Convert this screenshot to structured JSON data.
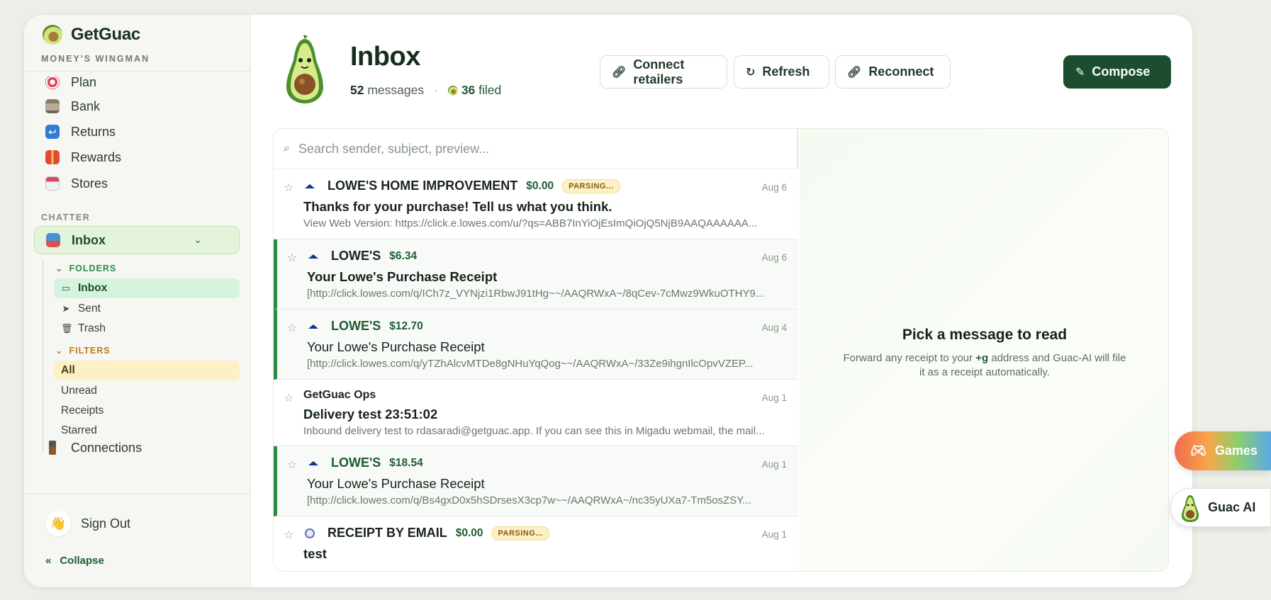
{
  "brand": {
    "name": "GetGuac",
    "tagline": "MONEY'S WINGMAN"
  },
  "sidebar": {
    "items": [
      {
        "label": "Plan",
        "icon": "target-icon"
      },
      {
        "label": "Bank",
        "icon": "bank-icon"
      },
      {
        "label": "Returns",
        "icon": "return-arrow-icon"
      },
      {
        "label": "Rewards",
        "icon": "gift-icon"
      },
      {
        "label": "Stores",
        "icon": "store-icon"
      }
    ],
    "chatter_label": "CHATTER",
    "inbox_label": "Inbox",
    "folders_label": "FOLDERS",
    "folders": [
      "Inbox",
      "Sent",
      "Trash"
    ],
    "filters_label": "FILTERS",
    "filters": [
      "All",
      "Unread",
      "Receipts",
      "Starred"
    ],
    "connections_label": "Connections",
    "signout_label": "Sign Out",
    "collapse_label": "Collapse"
  },
  "header": {
    "title": "Inbox",
    "message_count": "52",
    "messages_word": "messages",
    "filed_count": "36",
    "filed_word": "filed",
    "buttons": {
      "connect": "Connect retailers",
      "refresh": "Refresh",
      "reconnect": "Reconnect",
      "compose": "Compose"
    }
  },
  "search": {
    "placeholder": "Search sender, subject, preview..."
  },
  "messages": [
    {
      "sender": "LOWE'S HOME IMPROVEMENT",
      "amount": "$0.00",
      "badge": "PARSING...",
      "date": "Aug 6",
      "subject": "Thanks for your purchase! Tell us what you think.",
      "preview": "View Web Version: https://click.e.lowes.com/u/?qs=ABB7InYiOjEsImQiOjQ5NjB9AAQAAAAAA..."
    },
    {
      "sender": "LOWE'S",
      "amount": "$6.34",
      "date": "Aug 6",
      "subject": "Your Lowe's Purchase Receipt",
      "preview": "[http://click.lowes.com/q/ICh7z_VYNjzi1RbwJ91tHg~~/AAQRWxA~/8qCev-7cMwz9WkuOTHY9..."
    },
    {
      "sender": "LOWE'S",
      "amount": "$12.70",
      "date": "Aug 4",
      "subject": "Your Lowe's Purchase Receipt",
      "preview": "[http://click.lowes.com/q/yTZhAlcvMTDe8gNHuYqQog~~/AAQRWxA~/33Ze9ihgnIlcOpvVZEP..."
    },
    {
      "sender": "GetGuac Ops",
      "date": "Aug 1",
      "subject": "Delivery test 23:51:02",
      "preview": "Inbound delivery test to rdasaradi@getguac.app. If you can see this in Migadu webmail, the mail..."
    },
    {
      "sender": "LOWE'S",
      "amount": "$18.54",
      "date": "Aug 1",
      "subject": "Your Lowe's Purchase Receipt",
      "preview": "[http://click.lowes.com/q/Bs4gxD0x5hSDrsesX3cp7w~~/AAQRWxA~/nc35yUXa7-Tm5osZSY..."
    },
    {
      "sender": "RECEIPT BY EMAIL",
      "amount": "$0.00",
      "badge": "PARSING...",
      "date": "Aug 1",
      "subject": "test"
    }
  ],
  "reader": {
    "title": "Pick a message to read",
    "sub_before": "Forward any receipt to your",
    "sub_code": "+g",
    "sub_after": "address and Guac-AI will file it as a receipt automatically."
  },
  "floating": {
    "games": "Games",
    "guac_ai": "Guac AI"
  },
  "colors": {
    "brand_green": "#1b4d2e",
    "accent_green": "#2e8a47",
    "badge_yellow": "#fdf0c6"
  }
}
